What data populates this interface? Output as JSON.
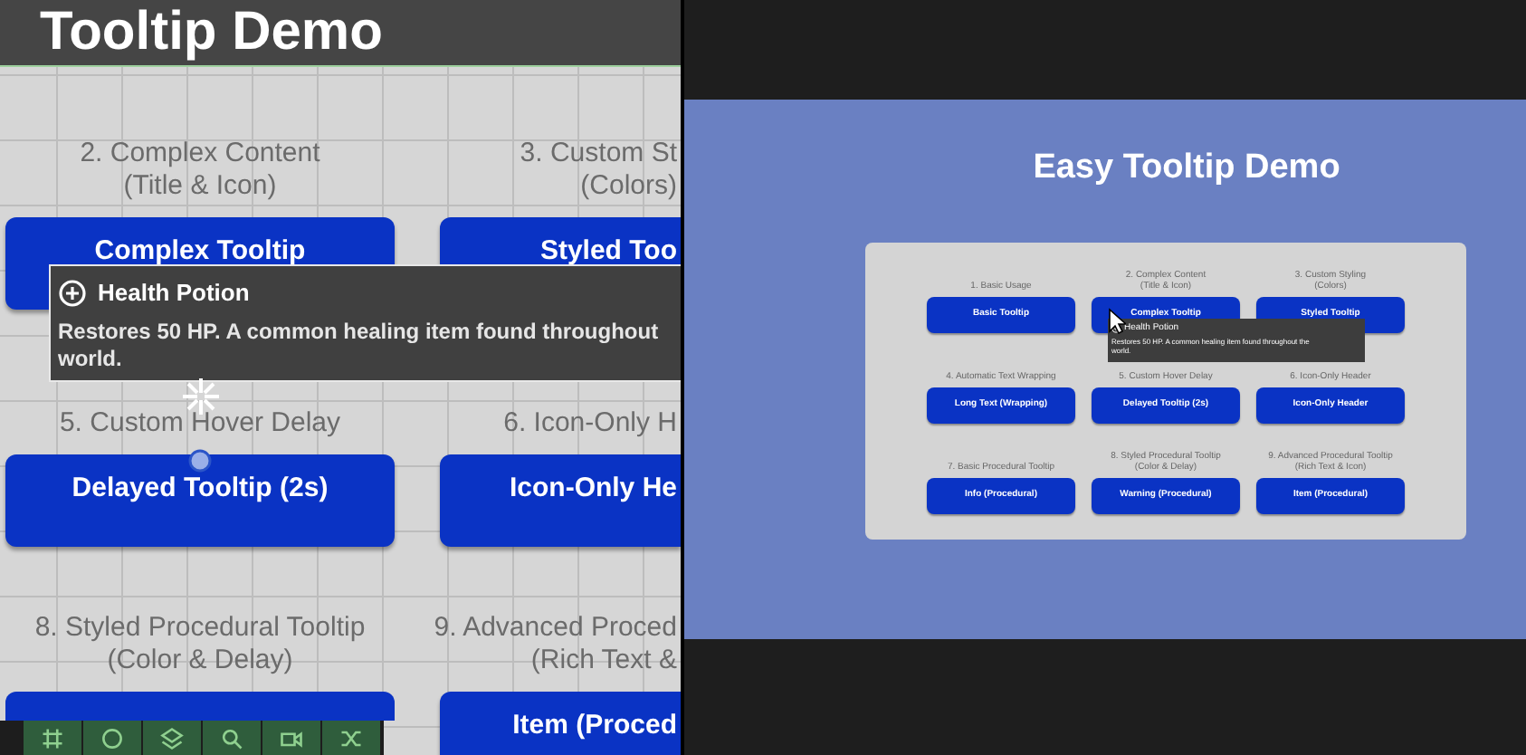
{
  "scene": {
    "title": "Tooltip Demo",
    "cells": [
      {
        "label": [
          "2. Complex Content",
          "(Title & Icon)"
        ],
        "button": "Complex Tooltip"
      },
      {
        "label": [
          "3. Custom St",
          "(Colors)"
        ],
        "button": "Styled Too"
      },
      {
        "label": [
          "5. Custom Hover Delay"
        ],
        "button": "Delayed Tooltip (2s)"
      },
      {
        "label": [
          "6. Icon-Only H"
        ],
        "button": "Icon-Only He"
      },
      {
        "label": [
          "8. Styled Procedural Tooltip",
          "(Color & Delay)"
        ]
      },
      {
        "label": [
          "9. Advanced Proced",
          "(Rich Text &"
        ],
        "button": "Item (Proced"
      }
    ],
    "tooltip": {
      "title": "Health Potion",
      "body": [
        "Restores 50 HP. A common healing item found throughout",
        "world."
      ]
    }
  },
  "game": {
    "title": "Easy Tooltip Demo",
    "cells": [
      {
        "label": [
          "1. Basic Usage"
        ],
        "button": "Basic Tooltip"
      },
      {
        "label": [
          "2. Complex Content",
          "(Title & Icon)"
        ],
        "button": "Complex Tooltip"
      },
      {
        "label": [
          "3. Custom Styling",
          "(Colors)"
        ],
        "button": "Styled Tooltip"
      },
      {
        "label": [
          "4. Automatic Text Wrapping"
        ],
        "button": "Long Text (Wrapping)"
      },
      {
        "label": [
          "5. Custom Hover Delay"
        ],
        "button": "Delayed Tooltip (2s)"
      },
      {
        "label": [
          "6. Icon-Only Header"
        ],
        "button": "Icon-Only Header"
      },
      {
        "label": [
          "7. Basic Procedural Tooltip"
        ],
        "button": "Info (Procedural)"
      },
      {
        "label": [
          "8. Styled Procedural Tooltip",
          "(Color & Delay)"
        ],
        "button": "Warning (Procedural)"
      },
      {
        "label": [
          "9. Advanced Procedural Tooltip",
          "(Rich Text & Icon)"
        ],
        "button": "Item (Procedural)"
      }
    ],
    "tooltip": {
      "title": "Health Potion",
      "body": [
        "Restores 50 HP. A common healing item found throughout the",
        "world."
      ]
    }
  }
}
